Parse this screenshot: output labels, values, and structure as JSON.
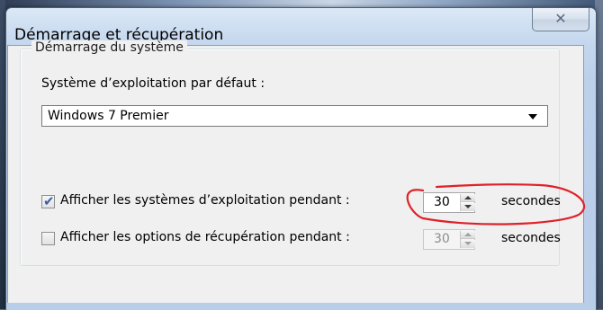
{
  "window": {
    "title": "Démarrage et récupération",
    "close_glyph": "✕"
  },
  "startup": {
    "group_label": "Démarrage du système",
    "default_os_label": "Système d’exploitation par défaut :",
    "default_os_value": "Windows 7 Premier",
    "show_os_list": {
      "checked": true,
      "label": "Afficher les systèmes d’exploitation pendant :",
      "value": "30",
      "unit": "secondes"
    },
    "show_recovery": {
      "checked": false,
      "label": "Afficher les options de récupération pendant :",
      "value": "30",
      "unit": "secondes",
      "enabled": false
    }
  },
  "annotation": {
    "color": "#e0202a"
  }
}
